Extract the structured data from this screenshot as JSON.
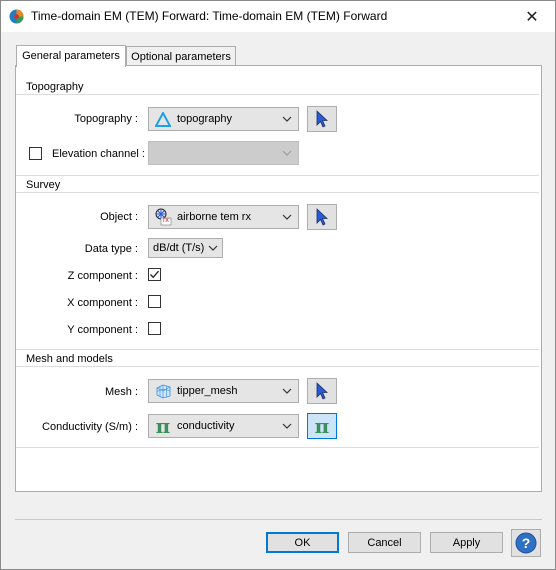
{
  "window": {
    "title": "Time-domain EM (TEM) Forward: Time-domain EM (TEM) Forward",
    "close_glyph": "✕"
  },
  "tabs": [
    {
      "label": "General parameters",
      "active": true
    },
    {
      "label": "Optional parameters",
      "active": false
    }
  ],
  "topography": {
    "group_title": "Topography",
    "topography_label": "Topography :",
    "topography_value": "topography",
    "elevation_label": "Elevation channel :",
    "elevation_checked": false,
    "elevation_value": ""
  },
  "survey": {
    "group_title": "Survey",
    "object_label": "Object :",
    "object_value": "airborne tem rx",
    "object_icon_text": "rx",
    "data_type_label": "Data type :",
    "data_type_value": "dB/dt (T/s)",
    "z_label": "Z component :",
    "z_checked": true,
    "x_label": "X component :",
    "x_checked": false,
    "y_label": "Y component :",
    "y_checked": false
  },
  "mesh": {
    "group_title": "Mesh and models",
    "mesh_label": "Mesh :",
    "mesh_value": "tipper_mesh",
    "conductivity_label": "Conductivity (S/m) :",
    "conductivity_value": "conductivity",
    "pi_glyph": "π"
  },
  "buttons": {
    "ok": "OK",
    "cancel": "Cancel",
    "apply": "Apply",
    "help_glyph": "?"
  },
  "colors": {
    "accent": "#0078d7",
    "pi_green": "#3a8f5a",
    "topo_blue": "#1ea0e6"
  }
}
